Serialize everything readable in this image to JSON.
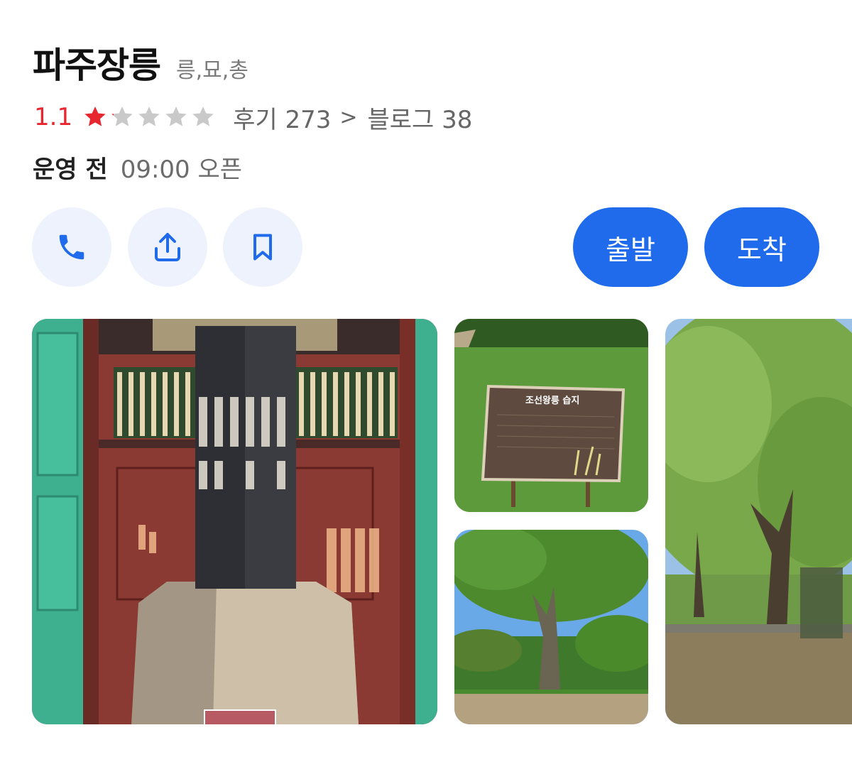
{
  "place": {
    "name": "파주장릉",
    "category": "릉,묘,총"
  },
  "rating": {
    "score": "1.1",
    "score_value": 1.1,
    "max_stars": 5,
    "reviews_label": "후기 273",
    "blog_label": "블로그 38"
  },
  "hours": {
    "status": "운영 전",
    "open_text": "09:00 오픈"
  },
  "actions": {
    "call_icon": "phone-icon",
    "share_icon": "share-icon",
    "save_icon": "bookmark-icon",
    "depart_label": "출발",
    "arrive_label": "도착"
  },
  "photos": {
    "sign_title": "조선왕릉 습지"
  },
  "colors": {
    "accent": "#1f6bec",
    "rating": "#e8262f",
    "circle_bg": "#eef2fc"
  }
}
